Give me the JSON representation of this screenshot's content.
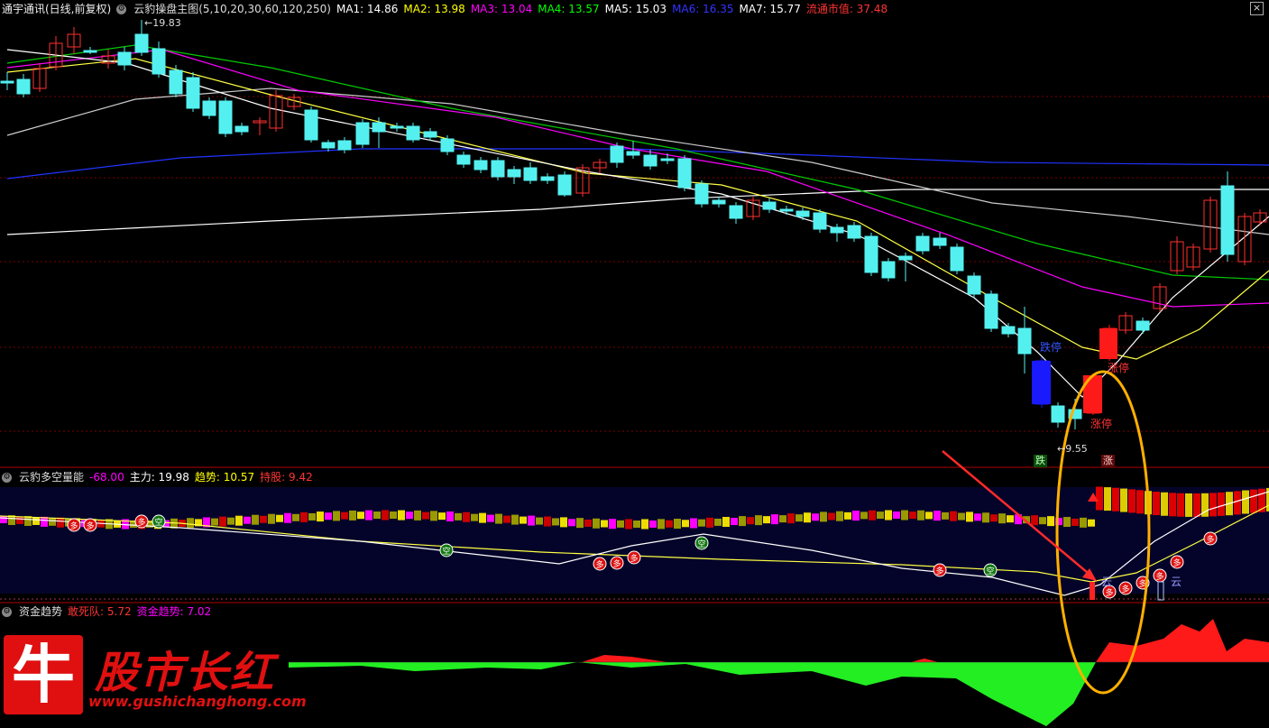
{
  "main_header": {
    "stock": "通宇通讯(日线,前复权)",
    "indicator": "云豹操盘主图(5,10,20,30,60,120,250)",
    "ma": [
      {
        "label": "MA1: 14.86",
        "color": "#ffffff"
      },
      {
        "label": "MA2: 13.98",
        "color": "#ffff00"
      },
      {
        "label": "MA3: 13.04",
        "color": "#ff00ff"
      },
      {
        "label": "MA4: 13.57",
        "color": "#00ff00"
      },
      {
        "label": "MA5: 15.03",
        "color": "#ffffff"
      },
      {
        "label": "MA6: 16.35",
        "color": "#0000ff"
      },
      {
        "label": "MA7: 15.77",
        "color": "#ffffff"
      }
    ],
    "market_cap": "流通市值: 37.48",
    "market_cap_color": "#ff3333"
  },
  "main_chart": {
    "high_label": "19.83",
    "low_label": "9.55",
    "limit_down": "跌停",
    "limit_up_1": "涨停",
    "limit_up_2": "涨停",
    "down_marker": "跌",
    "up_marker": "涨"
  },
  "sub1_header": {
    "name": "云豹多空量能",
    "v0": "-68.00",
    "v1": "主力: 19.98",
    "v2": "趋势: 10.57",
    "v3": "持股: 9.42"
  },
  "sub1_chart": {
    "duo": "多",
    "kong": "空",
    "yun": "云"
  },
  "sub2_header": {
    "name": "资金趋势",
    "v1": "敢死队: 5.72",
    "v2": "资金趋势: 7.02"
  },
  "watermark": {
    "logo_char": "牛",
    "title": "股市长红",
    "url": "www.gushichanghong.com"
  },
  "close_label": "×"
}
